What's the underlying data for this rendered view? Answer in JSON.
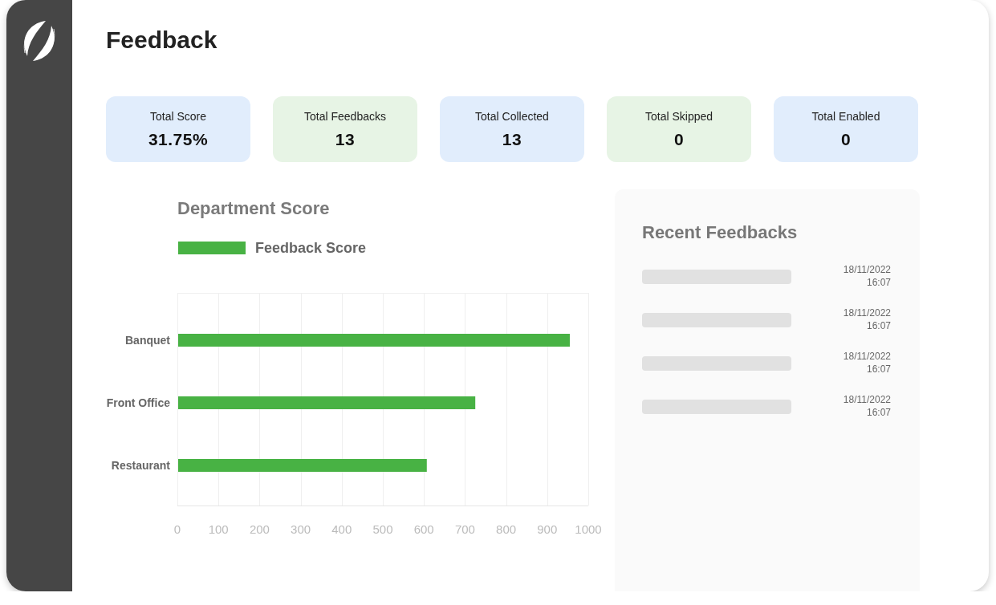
{
  "page": {
    "title": "Feedback"
  },
  "stats": [
    {
      "label": "Total Score",
      "value": "31.75%",
      "color": "#e1edfc"
    },
    {
      "label": "Total Feedbacks",
      "value": "13",
      "color": "#e7f4e5"
    },
    {
      "label": "Total Collected",
      "value": "13",
      "color": "#e1edfc"
    },
    {
      "label": "Total Skipped",
      "value": "0",
      "color": "#e7f4e5"
    },
    {
      "label": "Total Enabled",
      "value": "0",
      "color": "#e1edfc"
    }
  ],
  "department_score": {
    "chart_data": {
      "type": "bar",
      "orientation": "horizontal",
      "title": "Department Score",
      "categories": [
        "Banquet",
        "Front Office",
        "Restaurant"
      ],
      "series": [
        {
          "name": "Feedback Score",
          "color": "#48b244",
          "values": [
            955,
            725,
            607
          ]
        }
      ],
      "xlim": [
        0,
        1000
      ],
      "xticks": [
        0,
        100,
        200,
        300,
        400,
        500,
        600,
        700,
        800,
        900,
        1000
      ],
      "grid": true
    }
  },
  "recent_feedbacks": {
    "title": "Recent Feedbacks",
    "items": [
      {
        "date": "18/11/2022",
        "time": "16:07"
      },
      {
        "date": "18/11/2022",
        "time": "16:07"
      },
      {
        "date": "18/11/2022",
        "time": "16:07"
      },
      {
        "date": "18/11/2022",
        "time": "16:07"
      }
    ]
  }
}
